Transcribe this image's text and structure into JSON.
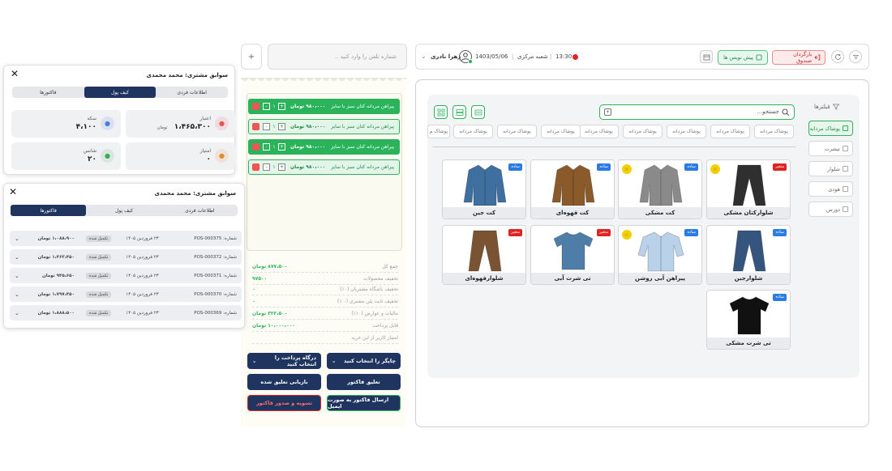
{
  "topbar": {
    "cashier": "زهرا نادری",
    "date": "1403/05/06",
    "branch": "شعبه مرکزی",
    "time": "13:30",
    "prefactor_label": "پیش نویس ها",
    "return_label": "بازگردان صندوق",
    "search_placeholder": "شماره تلفن را وارد کنید ..",
    "add_label": "+"
  },
  "catalog": {
    "search_placeholder": "جستجو...",
    "filters_label": "فیلترها",
    "chips": [
      "پوشاک مردانه",
      "پوشاک مردانه",
      "پوشاک مردانه",
      "پوشاک مردانه",
      "پوشاک مردانه",
      "پوشاک مردانه",
      "پوشاک مردانه",
      "پوشاک مردانه",
      "پوشاک م"
    ],
    "categories": [
      "پوشاک مردانه",
      "تیشرت",
      "شلوار",
      "هودی",
      "دورس"
    ],
    "products": [
      {
        "name": "شلوارکتان مشکی",
        "badge": "متغیر",
        "badge_color": "#e02424",
        "star": true,
        "color": "#2f2f2f",
        "type": "pants"
      },
      {
        "name": "کت مشکی",
        "badge": "ساده",
        "badge_color": "#2b7be4",
        "star": true,
        "color": "#8a8a8a",
        "type": "jacket"
      },
      {
        "name": "کت قهوه‌ای",
        "badge": "ساده",
        "badge_color": "#2b7be4",
        "star": false,
        "color": "#8b5a2b",
        "type": "jacket"
      },
      {
        "name": "کت جین",
        "badge": "ساده",
        "badge_color": "#2b7be4",
        "star": false,
        "color": "#3f6f9f",
        "type": "jacket"
      },
      {
        "name": "شلوارجین",
        "badge": "ساده",
        "badge_color": "#2b7be4",
        "star": false,
        "color": "#35557f",
        "type": "pants"
      },
      {
        "name": "پیراهن آبی روشن",
        "badge": "ساده",
        "badge_color": "#2b7be4",
        "star": true,
        "color": "#b9d2ea",
        "type": "shirt"
      },
      {
        "name": "تی شرت آبی",
        "badge": "متغیر",
        "badge_color": "#e02424",
        "star": false,
        "color": "#4e7ea8",
        "type": "tshirt"
      },
      {
        "name": "شلوارقهوه‌ای",
        "badge": "متغیر",
        "badge_color": "#e02424",
        "star": false,
        "color": "#7a5332",
        "type": "pants"
      },
      {
        "name": "تی شرت مشکی",
        "badge": "ساده",
        "badge_color": "#2b7be4",
        "star": false,
        "color": "#111111",
        "type": "tshirt"
      }
    ]
  },
  "cart": {
    "items": [
      {
        "name": "پیراهن مردانه کتان سبز با سایز",
        "price": "۹۸۰،۰۰۰ تومان",
        "qty": "۱",
        "active": true
      },
      {
        "name": "پیراهن مردانه کتان سبز با سایز",
        "price": "۹۸۰،۰۰۰ تومان",
        "qty": "۱",
        "active": false
      },
      {
        "name": "پیراهن مردانه کتان سبز با سایز",
        "price": "۹۸۰،۰۰۰ تومان",
        "qty": "۱",
        "active": true
      },
      {
        "name": "پیراهن مردانه کتان سبز با سایز",
        "price": "۹۸۰،۰۰۰ تومان",
        "qty": "۱",
        "active": false
      }
    ],
    "summary": [
      {
        "label": "جمع کل",
        "value": "۸۷۷،۵۰۰ تومان"
      },
      {
        "label": "تخفیف محصولات",
        "value": "۹۷۵۰۰"
      },
      {
        "label": "تخفیف باشگاه مشتریان (۰٪)",
        "value": "۰"
      },
      {
        "label": "تخفیف ثابت پلن مشتری (۰ ٪)",
        "value": "۰"
      },
      {
        "label": "مالیات و عوارض (۱۰٪)",
        "value": "۳۲۲،۵۰۰ تومان"
      },
      {
        "label": "قابل پرداخت",
        "value": "۱۰،۰۰۰،۰۰۰ تومان"
      },
      {
        "label": "امتیاز کاربر از این خرید",
        "value": ""
      }
    ],
    "printer_select": "چاپگر را انتخاب کنید",
    "gateway_select": "درگاه پرداخت را انتخاب کنید",
    "suspend_label": "تعلیق فاکتور",
    "restore_label": "بازیابی تعلیق شده",
    "email_label": "ارسال فاکتور به صورت ایمیل",
    "settle_label": "تسویه و صدور فاکتور"
  },
  "wallet_panel": {
    "title_prefix": "سوابق مشتری:",
    "customer": "محمد محمدی",
    "tabs": [
      "اطلاعات فردی",
      "کیف پول",
      "فاکتورها"
    ],
    "active_tab": 1,
    "stats": [
      {
        "label": "اعتبار",
        "value": "۱،۴۶۵،۳۰۰",
        "unit": "تومان"
      },
      {
        "label": "سکه",
        "value": "۴،۱۰۰",
        "unit": ""
      },
      {
        "label": "امتیاز",
        "value": "۰",
        "unit": ""
      },
      {
        "label": "شانس",
        "value": "۲۰",
        "unit": ""
      }
    ]
  },
  "invoice_panel": {
    "title_prefix": "سوابق مشتری:",
    "customer": "محمد محمدی",
    "tabs": [
      "اطلاعات فردی",
      "کیف پول",
      "فاکتورها"
    ],
    "active_tab": 2,
    "rows": [
      {
        "id": "شماره: POS-000375",
        "date": "۲۳ فروردین ۱۴۰۵",
        "status": "تکمیل شده",
        "amount": "۱،۰۸۸،۹۰۰ تومان"
      },
      {
        "id": "شماره: POS-000372",
        "date": "۲۳ فروردین ۱۴۰۵",
        "status": "تکمیل شده",
        "amount": "۱،۴۶۳،۴۵۰ تومان"
      },
      {
        "id": "شماره: POS-000371",
        "date": "۲۳ فروردین ۱۴۰۵",
        "status": "تکمیل شده",
        "amount": "۹۴۵،۶۵۰ تومان"
      },
      {
        "id": "شماره: POS-000370",
        "date": "۲۳ فروردین ۱۴۰۵",
        "status": "تکمیل شده",
        "amount": "۱،۷۹۷،۴۵۰ تومان"
      },
      {
        "id": "شماره: POS-000369",
        "date": "۲۳ فروردین ۱۴۰۵",
        "status": "تکمیل شده",
        "amount": "۱،۸۸۸،۵۰۰ تومان"
      }
    ]
  },
  "colors": {
    "green": "#2bb35c",
    "navy": "#1f3560",
    "red": "#e02424",
    "blue": "#2b7be4",
    "yellow": "#f2d000"
  }
}
